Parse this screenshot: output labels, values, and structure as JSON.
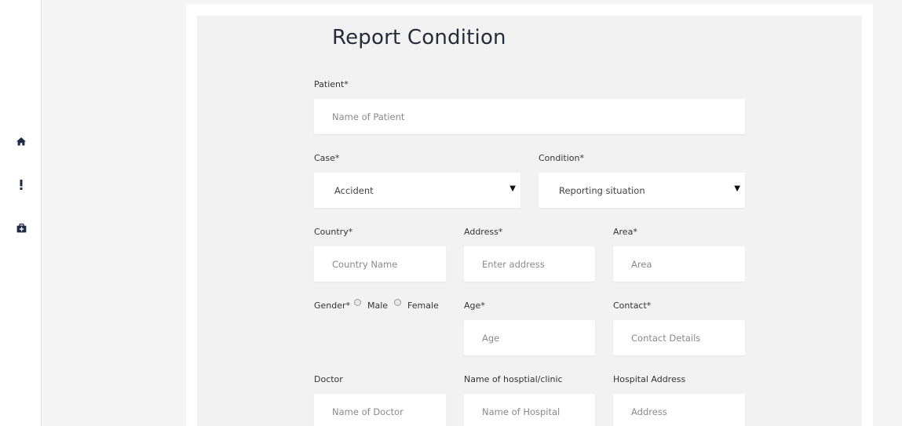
{
  "sidebar": {
    "items": [
      {
        "icon": "home-icon"
      },
      {
        "icon": "exclamation-icon"
      },
      {
        "icon": "medical-kit-icon"
      }
    ]
  },
  "form": {
    "title": "Report Condition",
    "patient": {
      "label": "Patient*",
      "placeholder": "Name of Patient"
    },
    "case": {
      "label": "Case*",
      "value": "Accident",
      "arrow": "▼"
    },
    "condition": {
      "label": "Condition*",
      "value": "Reporting situation",
      "arrow": "▼"
    },
    "country": {
      "label": "Country*",
      "placeholder": "Country Name"
    },
    "address": {
      "label": "Address*",
      "placeholder": "Enter address"
    },
    "area": {
      "label": "Area*",
      "placeholder": "Area"
    },
    "gender": {
      "label": "Gender*",
      "options": [
        "Male",
        "Female"
      ]
    },
    "age": {
      "label": "Age*",
      "placeholder": "Age"
    },
    "contact": {
      "label": "Contact*",
      "placeholder": "Contact Details"
    },
    "doctor": {
      "label": "Doctor",
      "placeholder": "Name of Doctor"
    },
    "hospital": {
      "label": "Name of hosptial/clinic",
      "placeholder": "Name of Hospital"
    },
    "hospital_address": {
      "label": "Hospital Address",
      "placeholder": "Address"
    }
  }
}
